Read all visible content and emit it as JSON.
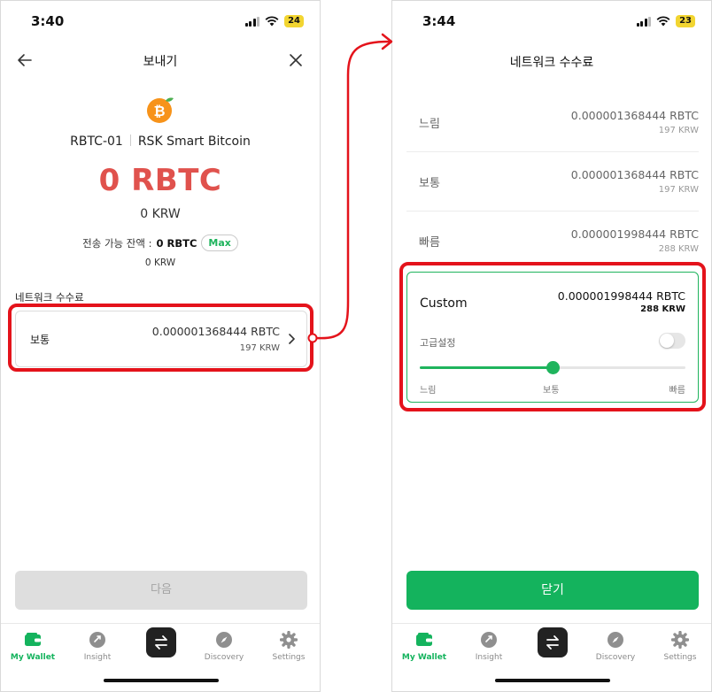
{
  "left": {
    "status": {
      "time": "3:40",
      "battery": "24"
    },
    "header": {
      "title": "보내기"
    },
    "coin": {
      "symbol": "RBTC-01",
      "name": "RSK Smart Bitcoin"
    },
    "amount": {
      "main": "0 RBTC",
      "krw": "0 KRW"
    },
    "balance": {
      "label": "전송 가능 잔액 :",
      "value": "0 RBTC",
      "max_label": "Max",
      "krw": "0 KRW"
    },
    "fee_section": {
      "label": "네트워크 수수료",
      "selected": {
        "name": "보통",
        "value": "0.000001368444 RBTC",
        "krw": "197 KRW"
      }
    },
    "next_button": "다음"
  },
  "right": {
    "status": {
      "time": "3:44",
      "battery": "23"
    },
    "title": "네트워크 수수료",
    "options": [
      {
        "name": "느림",
        "value": "0.000001368444 RBTC",
        "krw": "197 KRW"
      },
      {
        "name": "보통",
        "value": "0.000001368444 RBTC",
        "krw": "197 KRW"
      },
      {
        "name": "빠름",
        "value": "0.000001998444 RBTC",
        "krw": "288 KRW"
      }
    ],
    "custom": {
      "name": "Custom",
      "value": "0.000001998444 RBTC",
      "krw": "288 KRW",
      "advanced_label": "고급설정",
      "advanced_enabled": false,
      "slider": {
        "level_fraction": 0.5,
        "labels": [
          "느림",
          "보통",
          "빠름"
        ]
      }
    },
    "close_button": "닫기"
  },
  "tabs": [
    {
      "label": "My Wallet",
      "icon": "wallet-icon",
      "active": true
    },
    {
      "label": "Insight",
      "icon": "lightbulb-icon",
      "active": false
    },
    {
      "label": "",
      "icon": "swap-icon",
      "active": false
    },
    {
      "label": "Discovery",
      "icon": "compass-icon",
      "active": false
    },
    {
      "label": "Settings",
      "icon": "gear-icon",
      "active": false
    }
  ],
  "colors": {
    "accent_green": "#14b35d",
    "amount_red": "#e0524d",
    "highlight_red": "#e4131b",
    "bitcoin_orange": "#f7931a"
  }
}
